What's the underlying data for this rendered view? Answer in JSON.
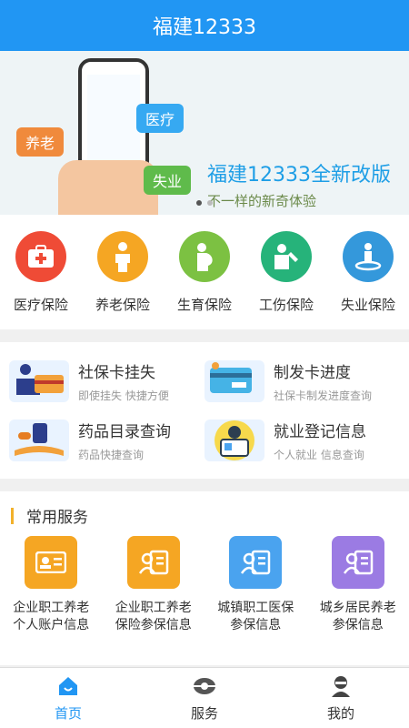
{
  "header": {
    "title": "福建12333"
  },
  "banner": {
    "tags": [
      "养老",
      "医疗",
      "失业"
    ],
    "title": "福建12333全新改版",
    "subtitle": "不一样的新奇体验",
    "dots": 2,
    "active_dot": 0
  },
  "insurance": [
    {
      "label": "医疗保险",
      "icon": "medical-kit-icon",
      "color": "#ef4b36"
    },
    {
      "label": "养老保险",
      "icon": "elderly-person-icon",
      "color": "#f5a623"
    },
    {
      "label": "生育保险",
      "icon": "pregnant-woman-icon",
      "color": "#7cc142"
    },
    {
      "label": "工伤保险",
      "icon": "injured-worker-icon",
      "color": "#26b37a"
    },
    {
      "label": "失业保险",
      "icon": "person-on-pedestal-icon",
      "color": "#3498db"
    }
  ],
  "quick": [
    {
      "title": "社保卡挂失",
      "sub": "即使挂失  快捷方便",
      "icon": "card-loss-icon"
    },
    {
      "title": "制发卡进度",
      "sub": "社保卡制发进度查询",
      "icon": "card-progress-icon"
    },
    {
      "title": "药品目录查询",
      "sub": "药品快捷查询",
      "icon": "medicine-book-icon"
    },
    {
      "title": "就业登记信息",
      "sub": "个人就业  信息查询",
      "icon": "employment-icon"
    }
  ],
  "common": {
    "title": "常用服务",
    "items": [
      {
        "label1": "企业职工养老",
        "label2": "个人账户信息",
        "color": "#f5a623"
      },
      {
        "label1": "企业职工养老",
        "label2": "保险参保信息",
        "color": "#f5a623"
      },
      {
        "label1": "城镇职工医保",
        "label2": "参保信息",
        "color": "#4aa3ef"
      },
      {
        "label1": "城乡居民养老",
        "label2": "参保信息",
        "color": "#9b7be3"
      }
    ]
  },
  "tabs": [
    {
      "label": "首页",
      "icon": "home-icon",
      "active": true
    },
    {
      "label": "服务",
      "icon": "eye-icon",
      "active": false
    },
    {
      "label": "我的",
      "icon": "user-icon",
      "active": false
    }
  ]
}
